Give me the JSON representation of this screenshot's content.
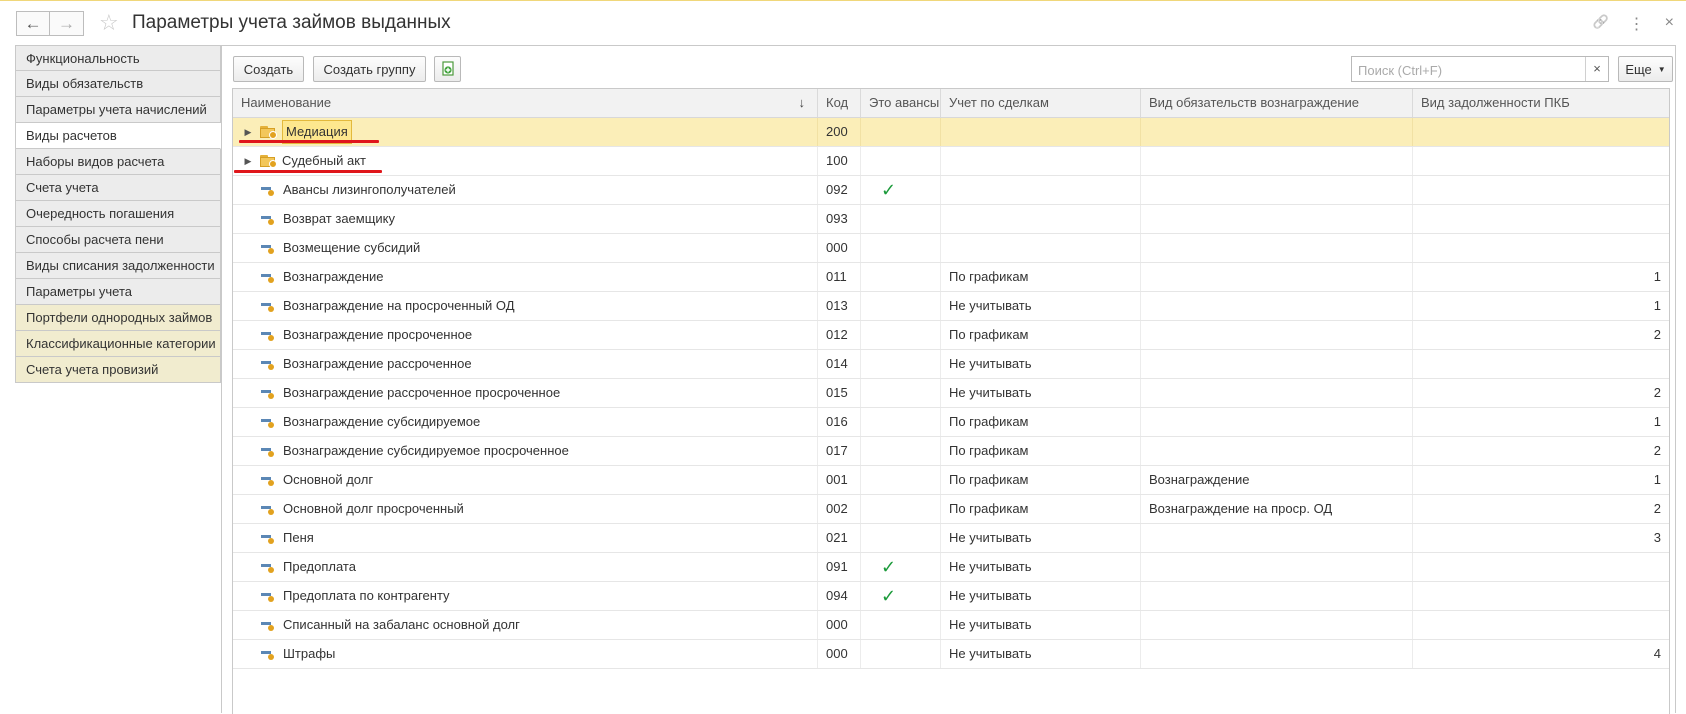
{
  "window": {
    "title": "Параметры учета займов выданных",
    "back_icon": "←",
    "forward_icon": "→",
    "star_icon": "☆",
    "link_icon": "🔗",
    "menu_icon": "⋮",
    "close_icon": "×"
  },
  "sidebar": {
    "items": [
      {
        "label": "Функциональность"
      },
      {
        "label": "Виды обязательств"
      },
      {
        "label": "Параметры учета начислений"
      },
      {
        "label": "Виды расчетов"
      },
      {
        "label": "Наборы видов расчета"
      },
      {
        "label": "Счета учета"
      },
      {
        "label": "Очередность погашения"
      },
      {
        "label": "Способы расчета пени"
      },
      {
        "label": "Виды списания задолженности"
      },
      {
        "label": "Параметры учета"
      },
      {
        "label": "Портфели однородных займов"
      },
      {
        "label": "Классификационные категории"
      },
      {
        "label": "Счета учета провизий"
      }
    ],
    "active_index": 3
  },
  "toolbar": {
    "create_label": "Создать",
    "create_group_label": "Создать группу",
    "search_placeholder": "Поиск (Ctrl+F)",
    "search_clear": "×",
    "more_label": "Еще"
  },
  "table": {
    "columns": [
      "Наименование",
      "Код",
      "Это авансы",
      "Учет по сделкам",
      "Вид обязательств вознаграждение",
      "Вид задолженности ПКБ"
    ],
    "sort_indicator": "↓",
    "check_mark": "✓",
    "rows": [
      {
        "name": "Медиация",
        "code": "200",
        "advance": false,
        "deals": "",
        "obligation": "",
        "pkb": "",
        "group": true,
        "selected": true
      },
      {
        "name": "Судебный акт",
        "code": "100",
        "advance": false,
        "deals": "",
        "obligation": "",
        "pkb": "",
        "group": true,
        "selected": false
      },
      {
        "name": "Авансы лизингополучателей",
        "code": "092",
        "advance": true,
        "deals": "",
        "obligation": "",
        "pkb": ""
      },
      {
        "name": "Возврат заемщику",
        "code": "093",
        "advance": false,
        "deals": "",
        "obligation": "",
        "pkb": ""
      },
      {
        "name": "Возмещение субсидий",
        "code": "000",
        "advance": false,
        "deals": "",
        "obligation": "",
        "pkb": ""
      },
      {
        "name": "Вознаграждение",
        "code": "011",
        "advance": false,
        "deals": "По графикам",
        "obligation": "",
        "pkb": "1"
      },
      {
        "name": "Вознаграждение на просроченный ОД",
        "code": "013",
        "advance": false,
        "deals": "Не учитывать",
        "obligation": "",
        "pkb": "1"
      },
      {
        "name": "Вознаграждение просроченное",
        "code": "012",
        "advance": false,
        "deals": "По графикам",
        "obligation": "",
        "pkb": "2"
      },
      {
        "name": "Вознаграждение рассроченное",
        "code": "014",
        "advance": false,
        "deals": "Не учитывать",
        "obligation": "",
        "pkb": ""
      },
      {
        "name": "Вознаграждение рассроченное просроченное",
        "code": "015",
        "advance": false,
        "deals": "Не учитывать",
        "obligation": "",
        "pkb": "2"
      },
      {
        "name": "Вознаграждение субсидируемое",
        "code": "016",
        "advance": false,
        "deals": "По графикам",
        "obligation": "",
        "pkb": "1"
      },
      {
        "name": "Вознаграждение субсидируемое просроченное",
        "code": "017",
        "advance": false,
        "deals": "По графикам",
        "obligation": "",
        "pkb": "2"
      },
      {
        "name": "Основной долг",
        "code": "001",
        "advance": false,
        "deals": "По графикам",
        "obligation": "Вознаграждение",
        "pkb": "1"
      },
      {
        "name": "Основной долг просроченный",
        "code": "002",
        "advance": false,
        "deals": "По графикам",
        "obligation": "Вознаграждение на проср. ОД",
        "pkb": "2"
      },
      {
        "name": "Пеня",
        "code": "021",
        "advance": false,
        "deals": "Не учитывать",
        "obligation": "",
        "pkb": "3"
      },
      {
        "name": "Предоплата",
        "code": "091",
        "advance": true,
        "deals": "Не учитывать",
        "obligation": "",
        "pkb": ""
      },
      {
        "name": "Предоплата по контрагенту",
        "code": "094",
        "advance": true,
        "deals": "Не учитывать",
        "obligation": "",
        "pkb": ""
      },
      {
        "name": "Списанный на забаланс основной долг",
        "code": "000",
        "advance": false,
        "deals": "Не учитывать",
        "obligation": "",
        "pkb": ""
      },
      {
        "name": "Штрафы",
        "code": "000",
        "advance": false,
        "deals": "Не учитывать",
        "obligation": "",
        "pkb": "4"
      }
    ]
  },
  "colors": {
    "selected_row": "#fbeeb8",
    "check": "#1b9a3a",
    "annotation_underline": "#e0161b"
  }
}
